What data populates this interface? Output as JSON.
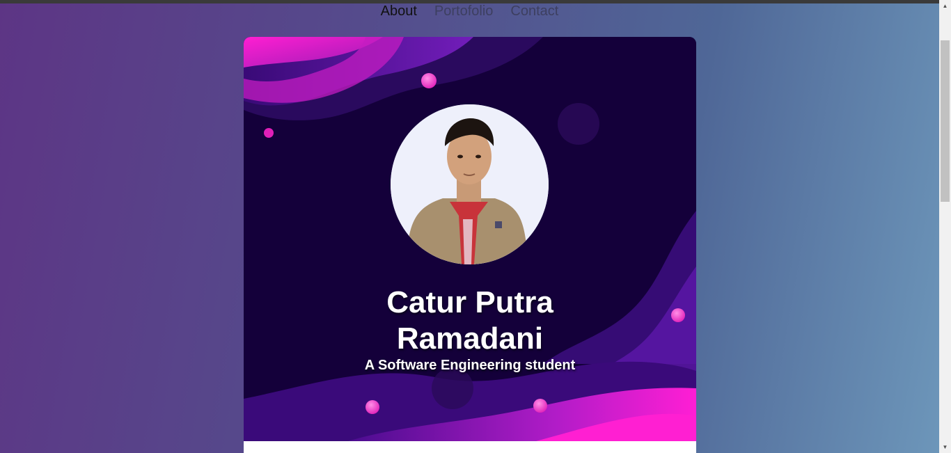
{
  "nav": {
    "items": [
      {
        "label": "About",
        "active": true
      },
      {
        "label": "Portofolio",
        "active": false
      },
      {
        "label": "Contact",
        "active": false
      }
    ]
  },
  "hero": {
    "name_line1": "Catur Putra",
    "name_line2": "Ramadani",
    "tagline": "A Software Engineering student",
    "background_color": "#14003a",
    "accent_pink": "#ff1fd2",
    "accent_purple": "#6a1fb0"
  },
  "icons": {
    "scroll_up": "chevron-up-icon",
    "scroll_down": "chevron-down-icon"
  }
}
